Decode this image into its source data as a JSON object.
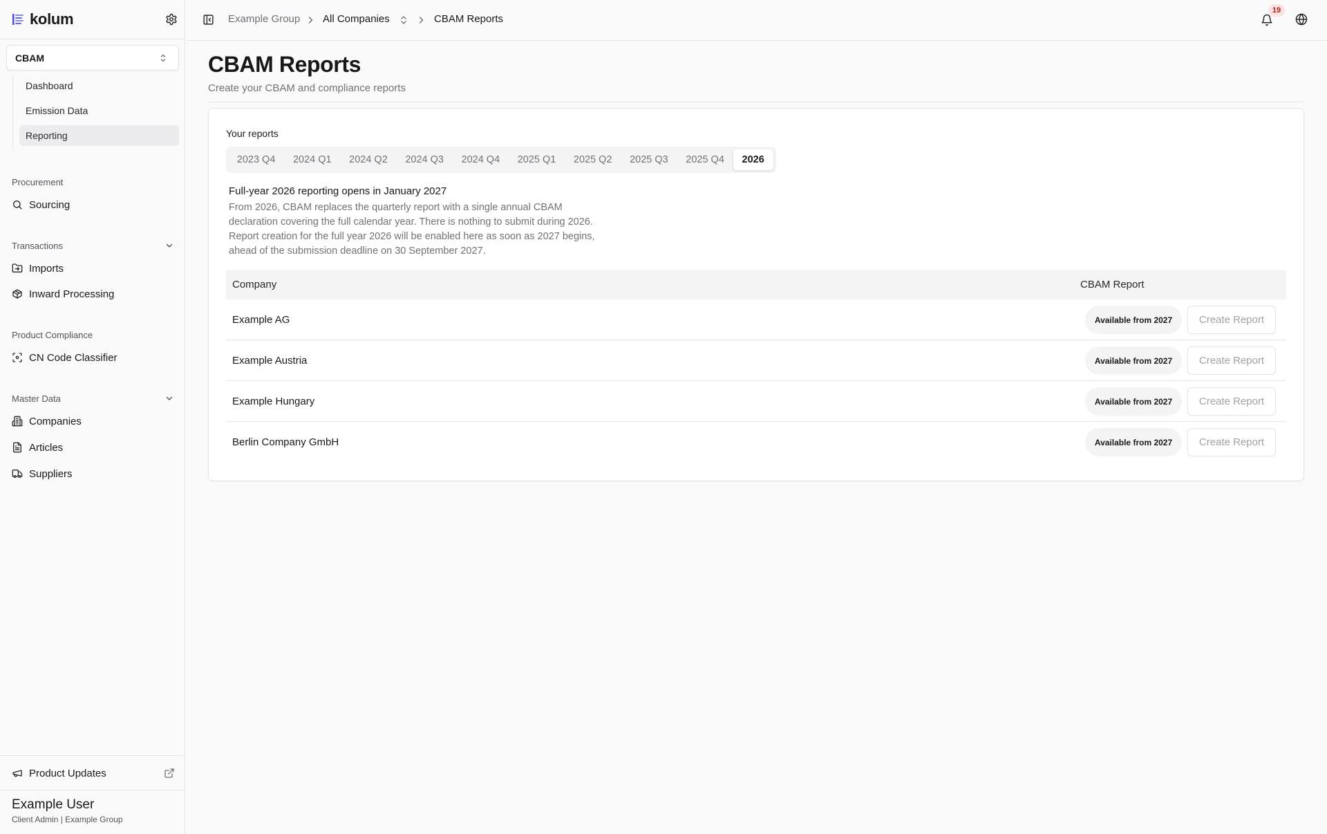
{
  "brand": {
    "name": "kolum"
  },
  "sidebar": {
    "module": "CBAM",
    "subnav": [
      {
        "label": "Dashboard",
        "active": false
      },
      {
        "label": "Emission Data",
        "active": false
      },
      {
        "label": "Reporting",
        "active": true
      }
    ],
    "sections": {
      "procurement": {
        "label": "Procurement",
        "items": [
          {
            "label": "Sourcing",
            "icon": "search-icon"
          }
        ]
      },
      "transactions": {
        "label": "Transactions",
        "items": [
          {
            "label": "Imports",
            "icon": "folder-import-icon"
          },
          {
            "label": "Inward Processing",
            "icon": "package-icon"
          }
        ]
      },
      "product_compliance": {
        "label": "Product Compliance",
        "items": [
          {
            "label": "CN Code Classifier",
            "icon": "scan-icon"
          }
        ]
      },
      "master_data": {
        "label": "Master Data",
        "items": [
          {
            "label": "Companies",
            "icon": "building-icon"
          },
          {
            "label": "Articles",
            "icon": "document-icon"
          },
          {
            "label": "Suppliers",
            "icon": "truck-icon"
          }
        ]
      }
    },
    "product_updates": "Product Updates",
    "user": {
      "name": "Example User",
      "role": "Client Admin | Example Group"
    }
  },
  "topbar": {
    "breadcrumb": [
      "Example Group",
      "All Companies",
      "CBAM Reports"
    ],
    "notification_count": "19"
  },
  "page": {
    "title": "CBAM Reports",
    "subtitle": "Create your CBAM and compliance reports"
  },
  "reports": {
    "label": "Your reports",
    "periods": [
      "2023 Q4",
      "2024 Q1",
      "2024 Q2",
      "2024 Q3",
      "2024 Q4",
      "2025 Q1",
      "2025 Q2",
      "2025 Q3",
      "2025 Q4",
      "2026"
    ],
    "selected_period": "2026",
    "notice_title": "Full-year 2026 reporting opens in January 2027",
    "notice_body": "From 2026, CBAM replaces the quarterly report with a single annual CBAM declaration covering the full calendar year. There is nothing to submit during 2026. Report creation for the full year 2026 will be enabled here as soon as 2027 begins, ahead of the submission deadline on 30 September 2027."
  },
  "table": {
    "columns": [
      "Company",
      "CBAM Report"
    ],
    "rows": [
      {
        "company": "Example AG",
        "status": "Available from 2027",
        "action": "Create Report"
      },
      {
        "company": "Example Austria",
        "status": "Available from 2027",
        "action": "Create Report"
      },
      {
        "company": "Example Hungary",
        "status": "Available from 2027",
        "action": "Create Report"
      },
      {
        "company": "Berlin Company GmbH",
        "status": "Available from 2027",
        "action": "Create Report"
      }
    ]
  },
  "colors": {
    "accent_logo": "#4f46e5",
    "badge_bg": "#fee2e2",
    "badge_text": "#b91c1c"
  }
}
